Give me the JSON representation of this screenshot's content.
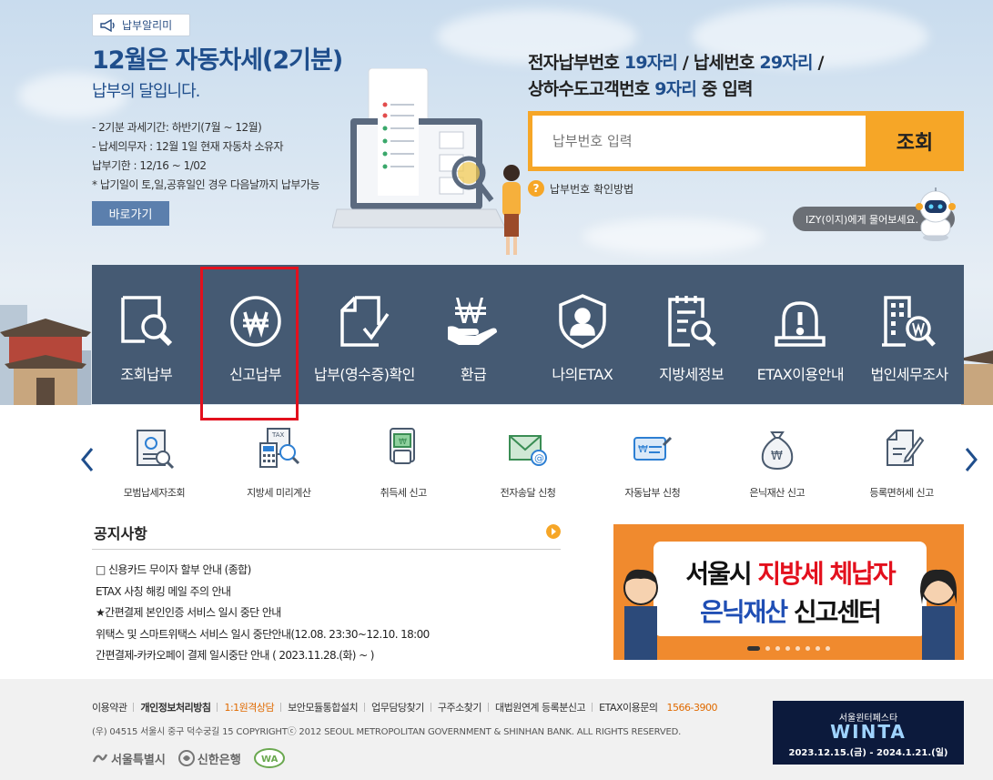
{
  "hero": {
    "tag": "납부알리미",
    "title": "12월은 자동차세(2기분)",
    "subtitle": "납부의 달입니다.",
    "info": [
      "- 2기분 과세기간: 하반기(7월 ~ 12월)",
      "- 납세의무자 : 12월 1일 현재 자동차 소유자",
      "납부기한 : 12/16 ~ 1/02",
      "* 납기일이 토,일,공휴일인 경우 다음날까지 납부가능"
    ],
    "go_button": "바로가기"
  },
  "search": {
    "line1_a": "전자납부번호 ",
    "line1_b": "19자리",
    "line1_c": " / 납세번호 ",
    "line1_d": "29자리",
    "line1_e": " /",
    "line2_a": "상하수도고객번호 ",
    "line2_b": "9자리",
    "line2_c": " 중 입력",
    "placeholder": "납부번호 입력",
    "button": "조회",
    "help": "납부번호 확인방법",
    "izy": "IZY(이지)에게 물어보세요."
  },
  "main_menu": [
    {
      "label": "조회납부",
      "icon": "search-doc-icon"
    },
    {
      "label": "신고납부",
      "icon": "won-circle-icon"
    },
    {
      "label": "납부(영수증)확인",
      "icon": "receipt-check-icon"
    },
    {
      "label": "환급",
      "icon": "refund-hand-icon"
    },
    {
      "label": "나의ETAX",
      "icon": "user-shield-icon"
    },
    {
      "label": "지방세정보",
      "icon": "notepad-search-icon"
    },
    {
      "label": "ETAX이용안내",
      "icon": "alert-bell-icon"
    },
    {
      "label": "법인세무조사",
      "icon": "building-won-icon"
    }
  ],
  "sub_menu": [
    {
      "label": "모범납세자조회",
      "icon": "certificate-search-icon"
    },
    {
      "label": "지방세 미리계산",
      "icon": "calculator-icon"
    },
    {
      "label": "취득세 신고",
      "icon": "wallet-icon"
    },
    {
      "label": "전자송달 신청",
      "icon": "email-icon"
    },
    {
      "label": "자동납부 신청",
      "icon": "card-icon"
    },
    {
      "label": "은닉재산 신고",
      "icon": "money-bag-icon"
    },
    {
      "label": "등록면허세 신고",
      "icon": "document-pen-icon"
    }
  ],
  "notices": {
    "title": "공지사항",
    "items": [
      "□ 신용카드 무이자 할부 안내 (종합)",
      "ETAX 사칭 해킹 메일 주의 안내",
      "★간편결제 본인인증 서비스 일시 중단 안내",
      "위택스 및 스마트위택스 서비스 일시 중단안내(12.08. 23:30~12.10. 18:00",
      "간편결제-카카오페이 결제 일시중단 안내 ( 2023.11.28.(화) ~ )"
    ]
  },
  "banner": {
    "line1_a": "서울시 ",
    "line1_b": "지방세 체납자",
    "line2_a": "은닉재산",
    "line2_b": " 신고센터"
  },
  "footer": {
    "links": [
      "이용약관",
      "개인정보처리방침",
      "1:1원격상담",
      "보안모듈통합설치",
      "업무담당찾기",
      "구주소찾기",
      "대법원연계 등록분신고",
      "ETAX이용문의"
    ],
    "phone": "1566-3900",
    "copyright": "(우) 04515 서울시 중구 덕수궁길 15 COPYRIGHTⓒ 2012 SEOUL METROPOLITAN GOVERNMENT & SHINHAN BANK. ALL RIGHTS RESERVED.",
    "logo_seoul": "서울특별시",
    "logo_shinhan": "신한은행",
    "fest_t1": "서울윈터페스타",
    "fest_t2": "WINTA",
    "fest_t3": "2023.12.15.(금) - 2024.1.21.(일)"
  }
}
